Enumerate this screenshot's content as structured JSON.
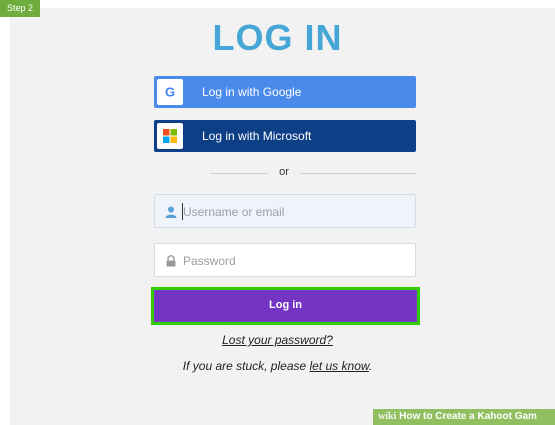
{
  "step_tag": "Step 2",
  "title": "LOG IN",
  "buttons": {
    "google_label": "Log in with Google",
    "google_icon": "google-g-icon",
    "microsoft_label": "Log in with Microsoft",
    "microsoft_icon": "microsoft-logo-icon"
  },
  "divider_text": "or",
  "fields": {
    "username_placeholder": "Username or email",
    "password_placeholder": "Password"
  },
  "login_button_label": "Log in",
  "lost_password_link": "Lost your password?",
  "stuck": {
    "prefix": "If you are stuck, please ",
    "link": "let us know",
    "suffix": "."
  },
  "watermark": {
    "brand": "wiki",
    "text": "How to Create a Kahoot Gam"
  },
  "colors": {
    "title": "#46a6d6",
    "google_button": "#4a8aea",
    "microsoft_button": "#0d3f86",
    "login_button": "#7534c4",
    "highlight": "#33cc00"
  }
}
